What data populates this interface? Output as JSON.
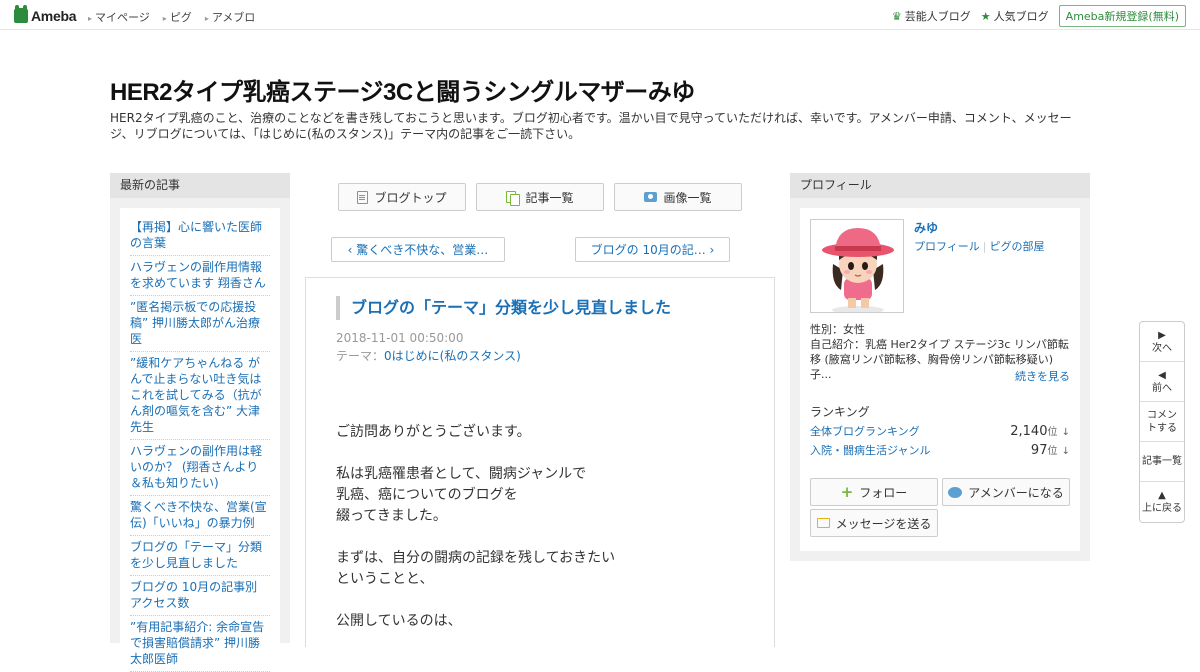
{
  "topbar": {
    "logo": "Ameba",
    "nav": [
      "マイページ",
      "ピグ",
      "アメブロ"
    ],
    "right_links": [
      "芸能人ブログ",
      "人気ブログ"
    ],
    "signup": "Ameba新規登録(無料)"
  },
  "header": {
    "title": "HER2タイプ乳癌ステージ3Cと闘うシングルマザーみゆ",
    "description": "HER2タイプ乳癌のこと、治療のことなどを書き残しておこうと思います。ブログ初心者です。温かい目で見守っていただければ、幸いです。アメンバー申請、コメント、メッセージ、リブログについては、「はじめに(私のスタンス)」テーマ内の記事をご一読下さい。"
  },
  "left": {
    "heading": "最新の記事",
    "articles": [
      "【再掲】心に響いた医師の言葉",
      "ハラヴェンの副作用情報を求めています 翔香さん",
      "”匿名掲示板での応援投稿” 押川勝太郎がん治療医",
      "”緩和ケアちゃんねる がんで止まらない吐き気はこれを試してみる（抗がん剤の嘔気を含む” 大津先生",
      "ハラヴェンの副作用は軽いのか？ (翔香さんより＆私も知りたい)",
      "驚くべき不快な、営業(宣伝)「いいね」の暴力例",
      "ブログの「テーマ」分類を少し見直しました",
      "ブログの 10月の記事別 アクセス数",
      "”有用記事紹介: 余命宣告で損害賠償請求” 押川勝太郎医師"
    ]
  },
  "center": {
    "buttons": [
      "ブログトップ",
      "記事一覧",
      "画像一覧"
    ],
    "prev": "驚くべき不快な、営業…",
    "next": "ブログの 10月の記…",
    "entry": {
      "title": "ブログの「テーマ」分類を少し見直しました",
      "date": "2018-11-01 00:50:00",
      "theme_label": "テーマ：",
      "theme": "0はじめに(私のスタンス)",
      "body": [
        "ご訪問ありがとうございます。",
        "",
        "私は乳癌罹患者として、闘病ジャンルで",
        "乳癌、癌についてのブログを",
        "綴ってきました。",
        "",
        "まずは、自分の闘病の記録を残しておきたい",
        "ということと、",
        "",
        "公開しているのは、"
      ]
    }
  },
  "right": {
    "heading": "プロフィール",
    "name": "みゆ",
    "links": [
      "プロフィール",
      "ピグの部屋"
    ],
    "gender": "性別：女性",
    "intro": "自己紹介：乳癌 Her2タイプ ステージ3c リンパ節転移 (腋窩リンパ節転移、胸骨傍リンパ節転移疑い) 子...",
    "more": "続きを見る",
    "ranking_heading": "ランキング",
    "rankings": [
      {
        "name": "全体ブログランキング",
        "value": "2,140",
        "unit": "位",
        "arrow": "↓"
      },
      {
        "name": "入院・闘病生活ジャンル",
        "value": "97",
        "unit": "位",
        "arrow": "↓"
      }
    ],
    "follow": "フォロー",
    "amember": "アメンバーになる",
    "message": "メッセージを送る"
  },
  "sidenav": {
    "next": "次へ",
    "prev": "前へ",
    "comment": "コメントする",
    "list": "記事一覧",
    "top": "上に戻る"
  },
  "colors": {
    "accent": "#1a6fb5",
    "brand": "#2d8c3c"
  }
}
